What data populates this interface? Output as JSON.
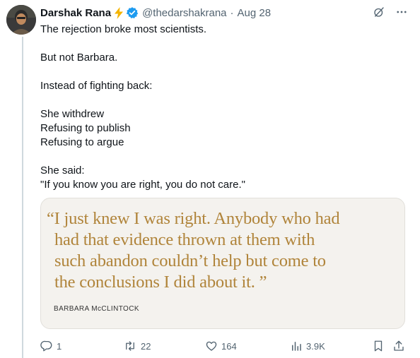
{
  "tweet": {
    "author_name": "Darshak Rana",
    "handle": "@thedarshakrana",
    "separator": "·",
    "date": "Aug 28",
    "lines": {
      "l1": "The rejection broke most scientists.",
      "l2": "But not Barbara.",
      "l3": "Instead of fighting back:",
      "l4": "She withdrew",
      "l5": "Refusing to publish",
      "l6": "Refusing to argue",
      "l7": "She said:",
      "l8": "\"If you know you are right, you do not care.\""
    }
  },
  "card": {
    "quote_lines": [
      "“I just knew I was right. Anybody who had",
      "had that evidence thrown at them with",
      "such abandon couldn’t help but come to",
      "the conclusions I did about it. ”"
    ],
    "attribution": "BARBARA McCLINTOCK"
  },
  "actions": {
    "replies": "1",
    "reposts": "22",
    "likes": "164",
    "views": "3.9K"
  },
  "colors": {
    "accent_blue": "#1d9bf0",
    "bolt_yellow": "#f4b400",
    "quote_gold": "#b0843a",
    "muted_text": "#536471"
  },
  "icons": [
    "lightning-icon",
    "verified-badge-icon",
    "grok-icon",
    "more-icon",
    "reply-icon",
    "repost-icon",
    "like-icon",
    "views-icon",
    "bookmark-icon",
    "share-icon"
  ]
}
